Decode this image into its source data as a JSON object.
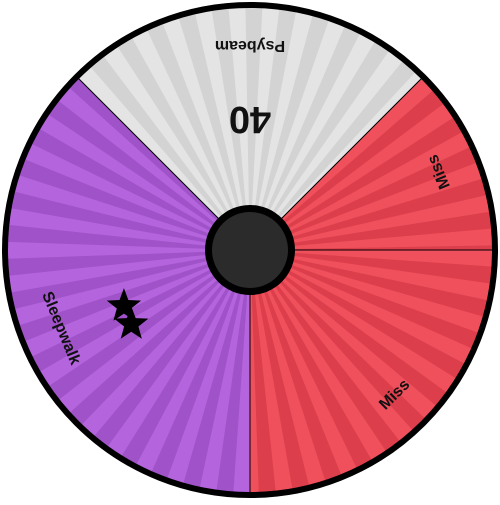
{
  "wheel": {
    "segments": [
      {
        "id": "psybeam",
        "label": "Psybeam",
        "power": "40",
        "stars": 0,
        "color_a": "#e4e4e4",
        "color_b": "#d3d3d3",
        "start_deg": -45,
        "end_deg": 45
      },
      {
        "id": "miss-1",
        "label": "Miss",
        "power": "",
        "stars": 0,
        "color_a": "#f0505c",
        "color_b": "#dc3e4b",
        "start_deg": 45,
        "end_deg": 90
      },
      {
        "id": "miss-2",
        "label": "Miss",
        "power": "",
        "stars": 0,
        "color_a": "#f0505c",
        "color_b": "#dc3e4b",
        "start_deg": 90,
        "end_deg": 180
      },
      {
        "id": "sleepwalk",
        "label": "Sleepwalk",
        "power": "",
        "stars": 2,
        "color_a": "#b464dc",
        "color_b": "#a052c8",
        "start_deg": 180,
        "end_deg": 315
      }
    ],
    "hub_color": "#2b2b2b",
    "rim_color": "#000000"
  }
}
